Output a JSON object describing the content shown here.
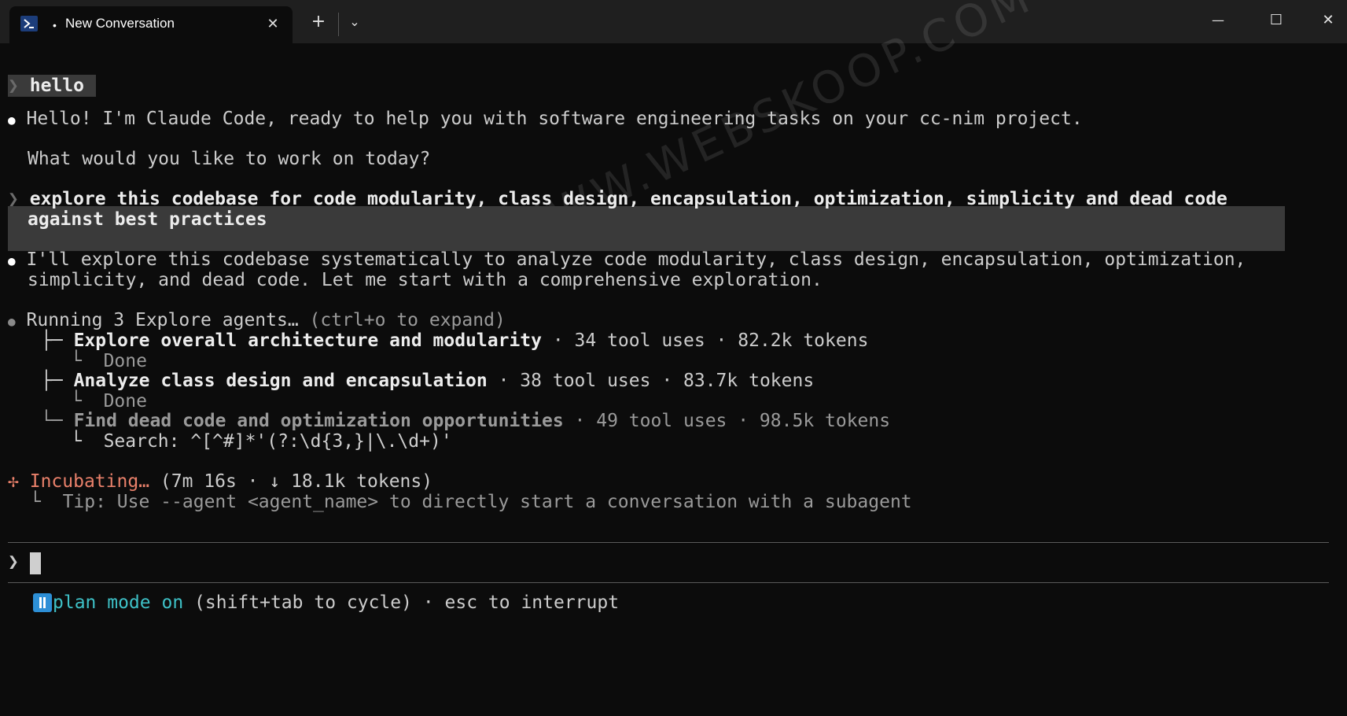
{
  "window": {
    "tab_title": "New Conversation",
    "tab_dot": "•",
    "new_tab_label": "+",
    "dropdown_label": "⌄",
    "close_tab_label": "✕",
    "minimize_label": "—",
    "maximize_label": "☐",
    "close_label": "✕"
  },
  "conversation": {
    "prompt_glyph": "❯",
    "bullet": "●",
    "user_msg_1": "hello",
    "assistant_msg_1_line1": "Hello! I'm Claude Code, ready to help you with software engineering tasks on your cc-nim project.",
    "assistant_msg_1_line2": "What would you like to work on today?",
    "user_msg_2_line1": "explore this codebase for code modularity, class design, encapsulation, optimization, simplicity and dead code",
    "user_msg_2_line2": "against best practices",
    "assistant_msg_2_line1": "I'll explore this codebase systematically to analyze code modularity, class design, encapsulation, optimization,",
    "assistant_msg_2_line2": "simplicity, and dead code. Let me start with a comprehensive exploration.",
    "agents_header": "Running 3 Explore agents…",
    "agents_hint": "(ctrl+o to expand)",
    "agents": [
      {
        "branch": "├─",
        "name": "Explore overall architecture and modularity",
        "stats": " · 34 tool uses · 82.2k tokens",
        "status_glyph": "└",
        "status": "Done"
      },
      {
        "branch": "├─",
        "name": "Analyze class design and encapsulation",
        "stats": " · 38 tool uses · 83.7k tokens",
        "status_glyph": "└",
        "status": "Done"
      },
      {
        "branch": "└─",
        "name": "Find dead code and optimization opportunities",
        "stats": " · 49 tool uses · 98.5k tokens",
        "status_glyph": "└",
        "status": "Search: ^[^#]*'(?:\\d{3,}|\\.\\d+)'"
      }
    ],
    "incubating_glyph": "✢",
    "incubating_label": "Incubating…",
    "incubating_stats": "(7m 16s · ↓ 18.1k tokens)",
    "tip_glyph": "└",
    "tip_text": "Tip: Use --agent <agent_name> to directly start a conversation with a subagent"
  },
  "input": {
    "prompt_glyph": "❯",
    "value": ""
  },
  "status_bar": {
    "mode_label": "plan mode on",
    "mode_hint": "(shift+tab to cycle) · esc to interrupt"
  },
  "watermark": "WWW.WEBSKOOP.COM",
  "colors": {
    "background": "#0c0c0c",
    "titlebar": "#1f1f1f",
    "user_highlight": "#3a3a3a",
    "incubating": "#e8806a",
    "plan_mode": "#3ec1c7",
    "pause_badge": "#2d8fd6"
  }
}
